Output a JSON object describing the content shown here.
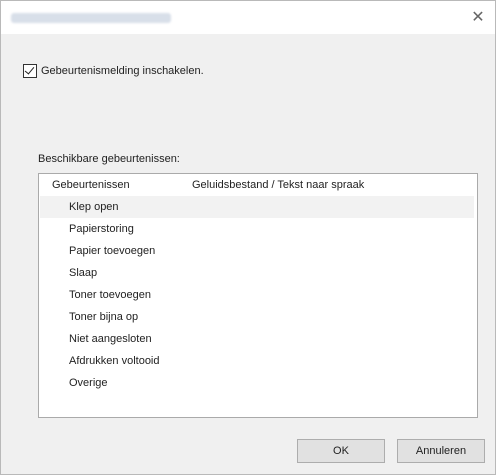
{
  "window": {
    "title_blurred": true,
    "close_symbol": "✕"
  },
  "option": {
    "enable_label": "Gebeurtenismelding inschakelen.",
    "checked": true
  },
  "available_label": "Beschikbare gebeurtenissen:",
  "table": {
    "columns": [
      "Gebeurtenissen",
      "Geluidsbestand / Tekst naar spraak"
    ],
    "rows": [
      "Klep open",
      "Papierstoring",
      "Papier toevoegen",
      "Slaap",
      "Toner toevoegen",
      "Toner bijna op",
      "Niet aangesloten",
      "Afdrukken voltooid",
      "Overige"
    ]
  },
  "buttons": {
    "ok": "OK",
    "cancel": "Annuleren"
  }
}
